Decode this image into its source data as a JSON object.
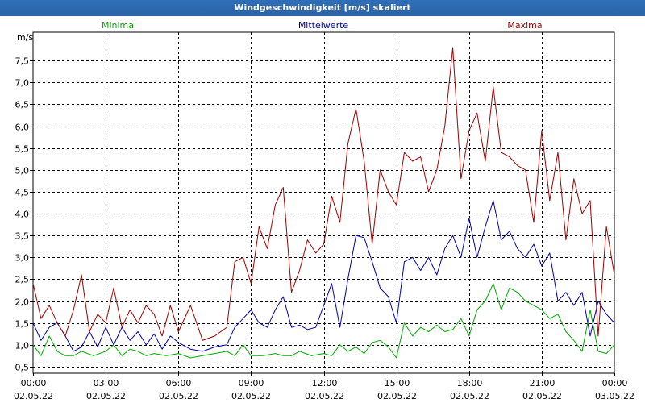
{
  "title": "Windgeschwindigkeit [m/s] skaliert",
  "chart_data": {
    "type": "line",
    "title": "Windgeschwindigkeit [m/s] skaliert",
    "ylabel": "m/s",
    "xlabel": "",
    "ylim": [
      0.35,
      8.15
    ],
    "xlim": [
      0,
      24
    ],
    "grid": true,
    "yticks": [
      "0,5",
      "1,0",
      "1,5",
      "2,0",
      "2,5",
      "3,0",
      "3,5",
      "4,0",
      "4,5",
      "5,0",
      "5,5",
      "6,0",
      "6,5",
      "7,0",
      "7,5"
    ],
    "ytick_values": [
      0.5,
      1.0,
      1.5,
      2.0,
      2.5,
      3.0,
      3.5,
      4.0,
      4.5,
      5.0,
      5.5,
      6.0,
      6.5,
      7.0,
      7.5
    ],
    "xticks": [
      {
        "time": "00:00",
        "date": "02.05.22",
        "x": 0
      },
      {
        "time": "03:00",
        "date": "02.05.22",
        "x": 3
      },
      {
        "time": "06:00",
        "date": "02.05.22",
        "x": 6
      },
      {
        "time": "09:00",
        "date": "02.05.22",
        "x": 9
      },
      {
        "time": "12:00",
        "date": "02.05.22",
        "x": 12
      },
      {
        "time": "15:00",
        "date": "02.05.22",
        "x": 15
      },
      {
        "time": "18:00",
        "date": "02.05.22",
        "x": 18
      },
      {
        "time": "21:00",
        "date": "02.05.22",
        "x": 21
      },
      {
        "time": "00:00",
        "date": "03.05.22",
        "x": 24
      }
    ],
    "series": [
      {
        "name": "Minima",
        "color": "#00aa00",
        "legend": "left",
        "x": [
          0,
          0.33,
          0.67,
          1,
          1.33,
          1.67,
          2,
          2.5,
          3,
          3.33,
          3.67,
          4,
          4.33,
          4.67,
          5,
          5.5,
          6,
          6.5,
          7,
          7.5,
          8,
          8.33,
          8.67,
          9,
          9.5,
          10,
          10.33,
          10.67,
          11,
          11.5,
          12,
          12.33,
          12.67,
          13,
          13.33,
          13.67,
          14,
          14.33,
          14.67,
          15,
          15.33,
          15.67,
          16,
          16.33,
          16.67,
          17,
          17.33,
          17.67,
          18,
          18.33,
          18.67,
          19,
          19.33,
          19.67,
          20,
          20.33,
          20.67,
          21,
          21.33,
          21.67,
          22,
          22.33,
          22.67,
          23,
          23.33,
          23.67,
          24
        ],
        "y": [
          1.0,
          0.75,
          1.2,
          0.85,
          0.75,
          0.75,
          0.85,
          0.75,
          0.85,
          1.0,
          0.75,
          0.9,
          0.85,
          0.75,
          0.8,
          0.75,
          0.8,
          0.7,
          0.75,
          0.8,
          0.85,
          0.75,
          1.0,
          0.75,
          0.75,
          0.8,
          0.75,
          0.75,
          0.85,
          0.75,
          0.8,
          0.75,
          1.0,
          0.85,
          0.95,
          0.8,
          1.05,
          1.1,
          0.95,
          0.7,
          1.5,
          1.2,
          1.4,
          1.3,
          1.45,
          1.3,
          1.35,
          1.6,
          1.2,
          1.8,
          2.0,
          2.4,
          1.8,
          2.3,
          2.2,
          2.0,
          1.9,
          1.8,
          1.6,
          1.7,
          1.3,
          1.1,
          0.85,
          1.8,
          0.85,
          0.8,
          1.0
        ]
      },
      {
        "name": "Mittelwerte",
        "color": "#0000b0",
        "legend": "center",
        "x": [
          0,
          0.33,
          0.67,
          1,
          1.33,
          1.67,
          2,
          2.33,
          2.67,
          3,
          3.33,
          3.67,
          4,
          4.33,
          4.67,
          5,
          5.33,
          5.67,
          6,
          6.5,
          7,
          7.5,
          8,
          8.33,
          8.67,
          9,
          9.33,
          9.67,
          10,
          10.33,
          10.67,
          11,
          11.33,
          11.67,
          12,
          12.33,
          12.67,
          13,
          13.33,
          13.67,
          14,
          14.33,
          14.67,
          15,
          15.33,
          15.67,
          16,
          16.33,
          16.67,
          17,
          17.33,
          17.67,
          18,
          18.33,
          18.67,
          19,
          19.33,
          19.67,
          20,
          20.33,
          20.67,
          21,
          21.33,
          21.67,
          22,
          22.33,
          22.67,
          23,
          23.33,
          23.67,
          24
        ],
        "y": [
          1.5,
          1.1,
          1.4,
          1.5,
          1.2,
          0.85,
          0.95,
          1.3,
          0.95,
          1.4,
          1.0,
          1.4,
          1.1,
          1.3,
          1.0,
          1.25,
          0.9,
          1.2,
          1.05,
          0.9,
          0.85,
          0.95,
          1.0,
          1.4,
          1.6,
          1.8,
          1.5,
          1.4,
          1.8,
          2.1,
          1.4,
          1.45,
          1.35,
          1.4,
          1.9,
          2.4,
          1.4,
          2.5,
          3.5,
          3.45,
          2.9,
          2.3,
          2.1,
          1.5,
          2.9,
          3.0,
          2.7,
          3.0,
          2.6,
          3.2,
          3.5,
          3.0,
          3.9,
          3.0,
          3.7,
          4.3,
          3.4,
          3.6,
          3.2,
          3.0,
          3.3,
          2.8,
          3.1,
          2.0,
          2.2,
          1.9,
          2.2,
          1.2,
          2.0,
          1.7,
          1.5
        ]
      },
      {
        "name": "Maxima",
        "color": "#a00000",
        "legend": "right",
        "x": [
          0,
          0.33,
          0.67,
          1,
          1.33,
          1.67,
          2,
          2.33,
          2.67,
          3,
          3.33,
          3.67,
          4,
          4.33,
          4.67,
          5,
          5.33,
          5.67,
          6,
          6.5,
          7,
          7.5,
          8,
          8.33,
          8.67,
          9,
          9.33,
          9.67,
          10,
          10.33,
          10.67,
          11,
          11.33,
          11.67,
          12,
          12.33,
          12.67,
          13,
          13.33,
          13.67,
          14,
          14.33,
          14.67,
          15,
          15.33,
          15.67,
          16,
          16.33,
          16.67,
          17,
          17.33,
          17.67,
          18,
          18.33,
          18.67,
          19,
          19.33,
          19.67,
          20,
          20.33,
          20.67,
          21,
          21.33,
          21.67,
          22,
          22.33,
          22.67,
          23,
          23.33,
          23.67,
          24
        ],
        "y": [
          2.4,
          1.6,
          1.9,
          1.5,
          1.2,
          1.8,
          2.6,
          1.3,
          1.7,
          1.5,
          2.3,
          1.4,
          1.8,
          1.5,
          1.9,
          1.7,
          1.2,
          1.9,
          1.3,
          1.9,
          1.1,
          1.2,
          1.4,
          2.9,
          3.0,
          2.4,
          3.7,
          3.2,
          4.2,
          4.6,
          2.2,
          2.7,
          3.4,
          3.1,
          3.3,
          4.4,
          3.8,
          5.6,
          6.4,
          5.2,
          3.3,
          5.0,
          4.5,
          4.2,
          5.4,
          5.2,
          5.3,
          4.5,
          5.0,
          6.0,
          7.8,
          4.8,
          5.9,
          6.3,
          5.2,
          6.9,
          5.4,
          5.3,
          5.1,
          5.0,
          3.8,
          5.9,
          4.3,
          5.4,
          3.4,
          4.8,
          4.0,
          4.3,
          1.2,
          3.7,
          2.6
        ]
      }
    ]
  }
}
